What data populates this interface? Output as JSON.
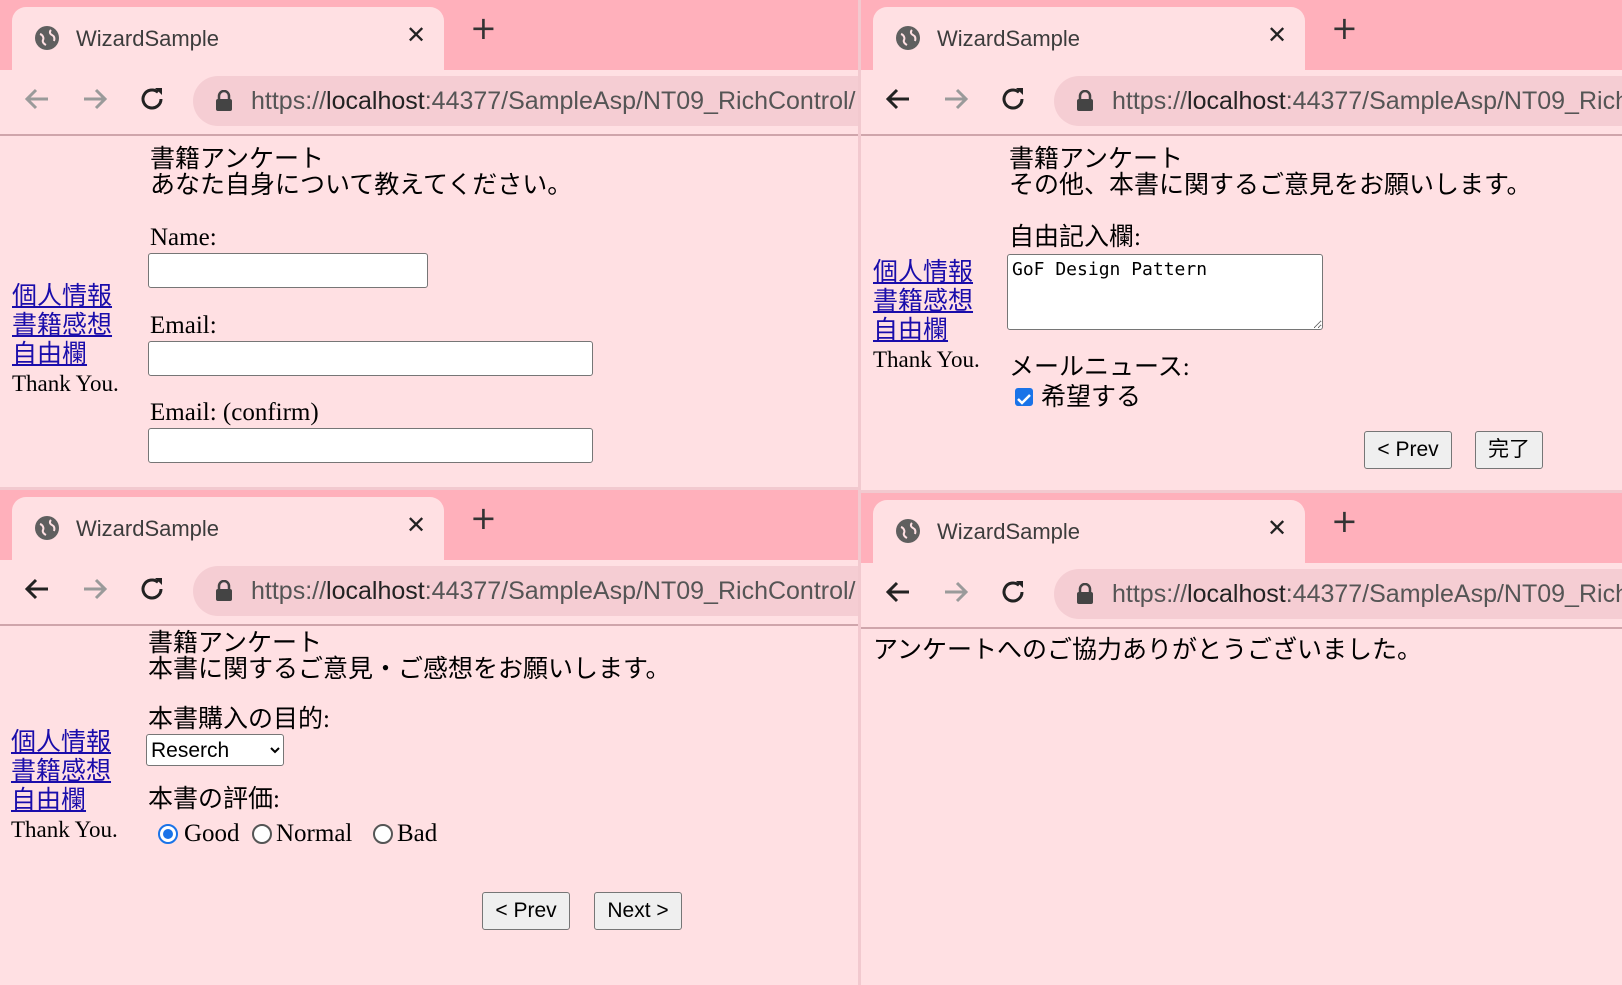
{
  "browser": {
    "tab_title": "WizardSample",
    "url_scheme": "https://",
    "url_host": "localhost",
    "url_path": ":44377/SampleAsp/NT09_RichControl/"
  },
  "sidebar": {
    "links": [
      "個人情報",
      "書籍感想",
      "自由欄"
    ],
    "thank_you": "Thank You."
  },
  "step1": {
    "heading": "書籍アンケート",
    "description": "あなた自身について教えてください。",
    "name_label": "Name:",
    "email_label": "Email:",
    "email_confirm_label": "Email: (confirm)",
    "name_value": "",
    "email_value": "",
    "email_confirm_value": ""
  },
  "step2": {
    "heading": "書籍アンケート",
    "description": "本書に関するご意見・ご感想をお願いします。",
    "purpose_label": "本書購入の目的:",
    "purpose_selected": "Reserch",
    "rating_label": "本書の評価:",
    "rating_options": [
      "Good",
      "Normal",
      "Bad"
    ],
    "rating_selected": "Good",
    "prev_label": "< Prev",
    "next_label": "Next >"
  },
  "step3": {
    "heading": "書籍アンケート",
    "description": "その他、本書に関するご意見をお願いします。",
    "free_label": "自由記入欄:",
    "free_text": "GoF Design Pattern",
    "mail_news_label": "メールニュース:",
    "mail_news_option": "希望する",
    "mail_news_checked": true,
    "prev_label": "< Prev",
    "finish_label": "完了"
  },
  "finish": {
    "message": "アンケートへのご協力ありがとうございました。"
  },
  "colors": {
    "tabbar": "#ffb0bb",
    "page_bg": "#ffe0e3",
    "link": "#1a0dab",
    "accent": "#1a73e8"
  },
  "icons": [
    "globe-icon",
    "close-icon",
    "plus-icon",
    "back-arrow-icon",
    "forward-arrow-icon",
    "reload-icon",
    "lock-icon"
  ]
}
